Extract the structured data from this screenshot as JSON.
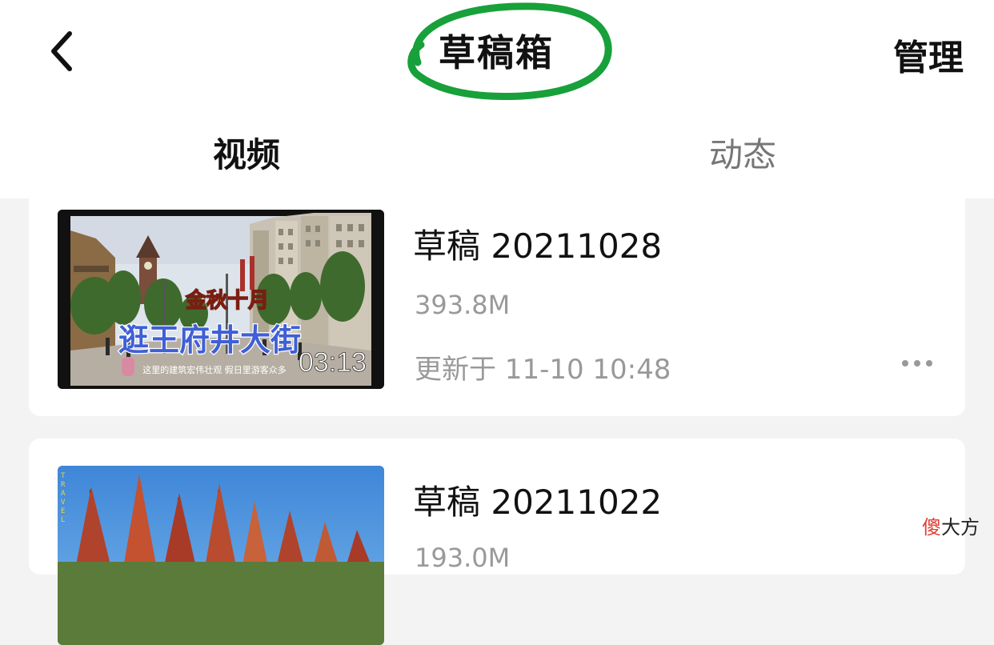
{
  "header": {
    "back_icon": "chevron-left-icon",
    "title": "草稿箱",
    "manage_label": "管理"
  },
  "tabs": [
    {
      "label": "视频",
      "active": true
    },
    {
      "label": "动态",
      "active": false
    }
  ],
  "drafts": [
    {
      "title": "草稿 20211028",
      "size": "393.8M",
      "updated": "更新于 11-10 10:48",
      "duration": "03:13",
      "thumbnail": {
        "caption_top": "金秋十月",
        "caption_main": "逛王府井大街",
        "subtitle": "这里的建筑宏伟壮观 假日里游客众多"
      },
      "more_icon": "more-dots-icon"
    },
    {
      "title": "草稿 20211022",
      "size": "193.0M",
      "thumbnail": {
        "side_text": "TRAVEL"
      }
    }
  ],
  "watermark": {
    "first": "傻",
    "rest": "大方"
  },
  "colors": {
    "accent_circle": "#18a03a",
    "background": "#f3f3f3",
    "card": "#ffffff",
    "text_primary": "#111111",
    "text_secondary": "#999999",
    "watermark_red": "#e43b2f"
  }
}
